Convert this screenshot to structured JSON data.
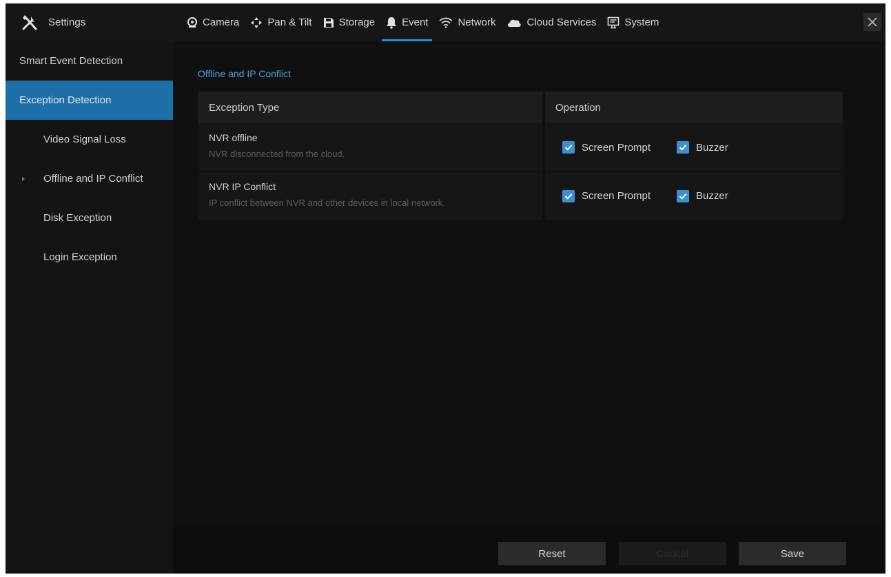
{
  "header": {
    "title": "Settings",
    "tabs": [
      {
        "label": "Camera",
        "icon": "camera-icon"
      },
      {
        "label": "Pan & Tilt",
        "icon": "pan-tilt-icon"
      },
      {
        "label": "Storage",
        "icon": "storage-icon"
      },
      {
        "label": "Event",
        "icon": "bell-icon",
        "active": true
      },
      {
        "label": "Network",
        "icon": "wifi-icon"
      },
      {
        "label": "Cloud Services",
        "icon": "cloud-icon"
      },
      {
        "label": "System",
        "icon": "system-icon"
      }
    ]
  },
  "sidebar": {
    "items": [
      {
        "label": "Smart Event Detection",
        "level": "top"
      },
      {
        "label": "Exception Detection",
        "level": "top",
        "active": true
      },
      {
        "label": "Video Signal Loss",
        "level": "sub"
      },
      {
        "label": "Offline and IP Conflict",
        "level": "sub",
        "current": true
      },
      {
        "label": "Disk Exception",
        "level": "sub"
      },
      {
        "label": "Login Exception",
        "level": "sub"
      }
    ]
  },
  "main": {
    "section_title": "Offline and IP Conflict",
    "columns": [
      "Exception Type",
      "Operation"
    ],
    "rows": [
      {
        "name": "NVR offline",
        "description": "NVR disconnected from the cloud.",
        "screen_prompt": {
          "label": "Screen Prompt",
          "checked": true
        },
        "buzzer": {
          "label": "Buzzer",
          "checked": true
        }
      },
      {
        "name": "NVR IP Conflict",
        "description": "IP conflict between NVR and other devices in local network.",
        "screen_prompt": {
          "label": "Screen Prompt",
          "checked": true
        },
        "buzzer": {
          "label": "Buzzer",
          "checked": true
        }
      }
    ]
  },
  "footer": {
    "reset_label": "Reset",
    "cancel_label": "Cancel",
    "save_label": "Save"
  },
  "colors": {
    "accent": "#2e8bd0",
    "sidebar_active": "#1d6fa8",
    "checkbox": "#3d8fd1",
    "section_title": "#4aa0df"
  }
}
